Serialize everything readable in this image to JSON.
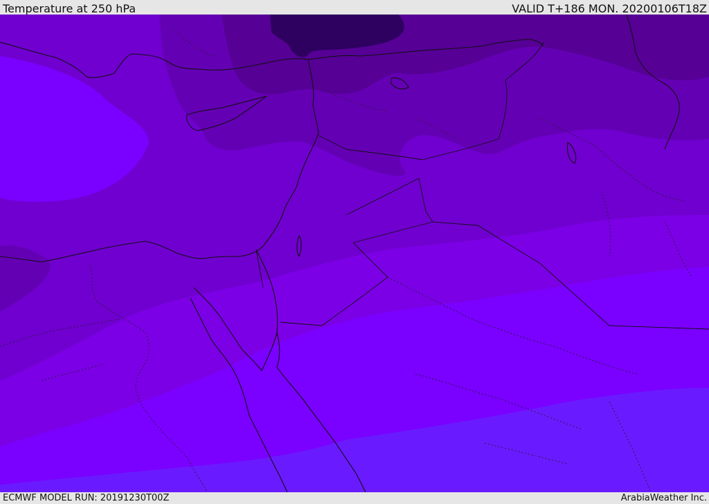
{
  "header": {
    "title": "Temperature at 250 hPa",
    "valid": "VALID T+186 MON. 20200106T18Z"
  },
  "footer": {
    "model_run": "ECMWF MODEL RUN: 20191230T00Z",
    "credit": "ArabiaWeather Inc."
  },
  "map": {
    "field_colors": [
      "#7a00ff",
      "#7c00e6",
      "#7000cf",
      "#6400b4",
      "#560096",
      "#2e0060",
      "#6a1aff"
    ]
  }
}
